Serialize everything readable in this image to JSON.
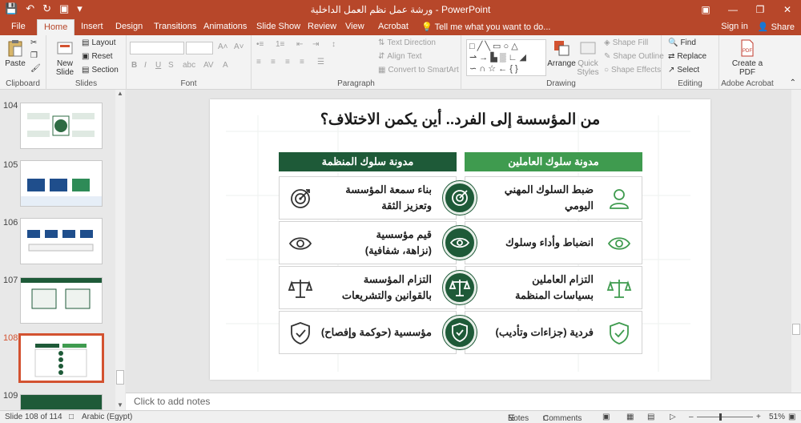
{
  "window": {
    "title": "ورشة عمل نظم العمل الداخلية  -  PowerPoint"
  },
  "tabs": [
    "File",
    "Home",
    "Insert",
    "Design",
    "Transitions",
    "Animations",
    "Slide Show",
    "Review",
    "View",
    "Acrobat"
  ],
  "active_tab": "Home",
  "tell_me": "Tell me what you want to do...",
  "signin": "Sign in",
  "share": "Share",
  "ribbon": {
    "clipboard": {
      "label": "Clipboard",
      "paste": "Paste"
    },
    "slides": {
      "label": "Slides",
      "new_slide": "New Slide",
      "layout": "Layout",
      "reset": "Reset",
      "section": "Section"
    },
    "font": {
      "label": "Font"
    },
    "paragraph": {
      "label": "Paragraph",
      "text_direction": "Text Direction",
      "align_text": "Align Text",
      "convert_smartart": "Convert to SmartArt"
    },
    "drawing": {
      "label": "Drawing",
      "arrange": "Arrange",
      "quick_styles": "Quick Styles",
      "shape_fill": "Shape Fill",
      "shape_outline": "Shape Outline",
      "shape_effects": "Shape Effects"
    },
    "editing": {
      "label": "Editing",
      "find": "Find",
      "replace": "Replace",
      "select": "Select"
    },
    "acrobat": {
      "label": "Adobe Acrobat",
      "create_pdf": "Create a PDF"
    }
  },
  "thumbnails": [
    {
      "num": "104"
    },
    {
      "num": "105"
    },
    {
      "num": "106"
    },
    {
      "num": "107"
    },
    {
      "num": "108",
      "selected": true
    },
    {
      "num": "109"
    }
  ],
  "slide": {
    "title": "من المؤسسة إلى الفرد.. أين يكمن الاختلاف؟",
    "left_header": "مدونة سلوك المنظمة",
    "right_header": "مدونة سلوك العاملين",
    "rows": [
      {
        "right": "ضبط السلوك المهني\nاليومي",
        "left": "بناء سمعة المؤسسة\nوتعزيز الثقة",
        "right_icon": "user-icon",
        "left_icon": "target-icon",
        "center_icon": "target-icon"
      },
      {
        "right": "انضباط وأداء وسلوك",
        "left": "قيم مؤسسية\n(نزاهة، شفافية)",
        "right_icon": "eye-icon",
        "left_icon": "eye-icon",
        "center_icon": "eye-icon"
      },
      {
        "right": "التزام العاملين\nبسياسات المنظمة",
        "left": "التزام المؤسسة\nبالقوانين والتشريعات",
        "right_icon": "scale-icon",
        "left_icon": "scale-icon",
        "center_icon": "scale-icon"
      },
      {
        "right": "فردية (جزاءات وتأديب)",
        "left": "مؤسسية (حوكمة وإفصاح)",
        "right_icon": "shield-check-icon",
        "left_icon": "shield-check-icon",
        "center_icon": "shield-check-icon"
      }
    ],
    "colors": {
      "dark_green": "#1e5a38",
      "light_green": "#3f9b4f"
    }
  },
  "notes_placeholder": "Click to add notes",
  "status": {
    "slide_info": "Slide 108 of 114",
    "language": "Arabic (Egypt)",
    "notes": "Notes",
    "comments": "Comments",
    "zoom": "51%"
  }
}
